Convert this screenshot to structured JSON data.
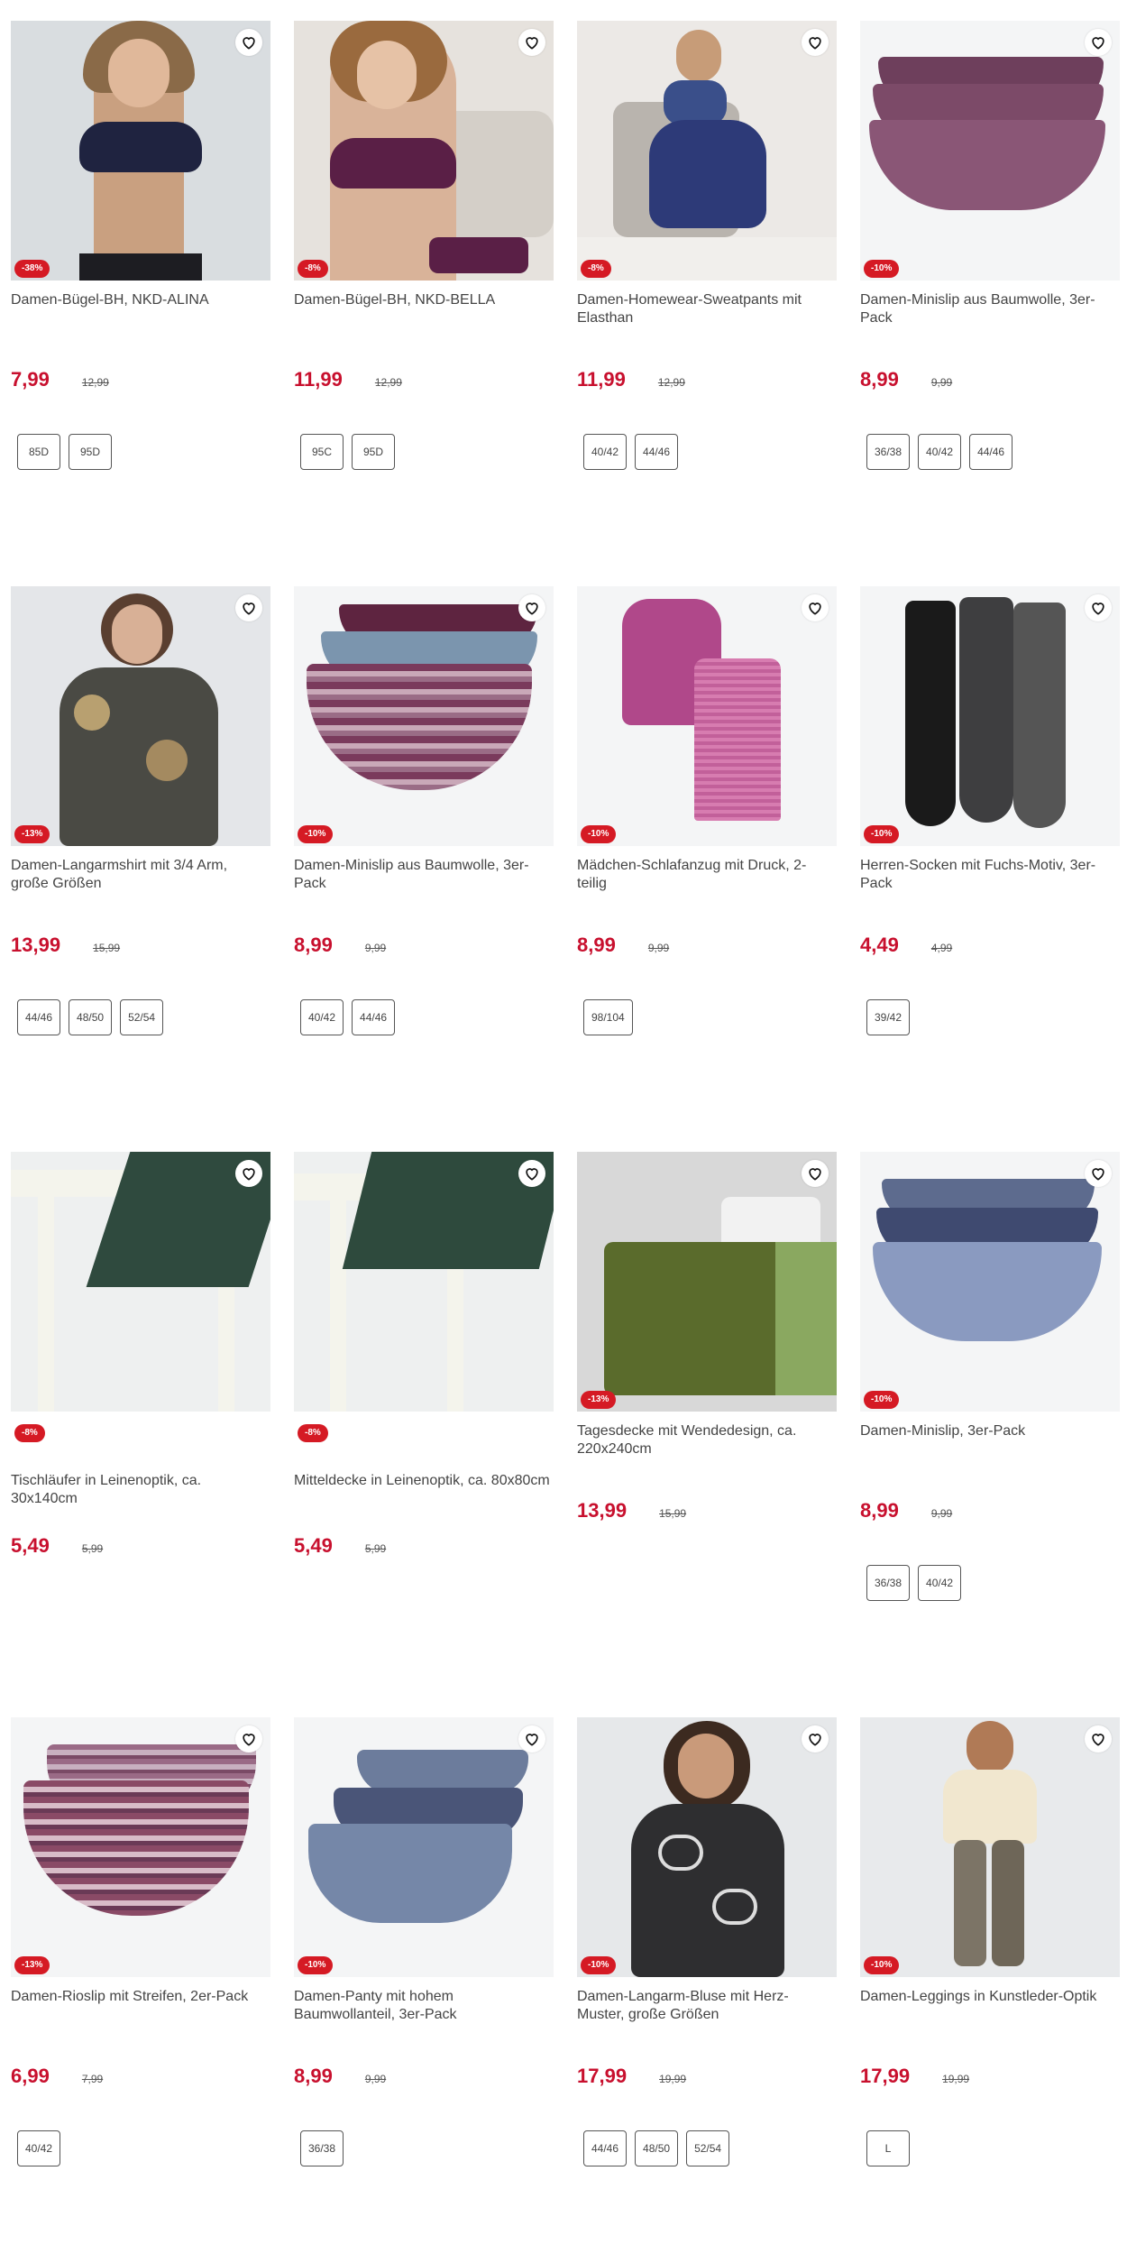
{
  "colors": {
    "sale_red": "#c8102e",
    "badge_red": "#d51a24"
  },
  "products": [
    {
      "title": "Damen-Bügel-BH, NKD-ALINA",
      "discount": "-38%",
      "price": "7,99",
      "old_price": "12,99",
      "sizes": [
        "85D",
        "95D"
      ]
    },
    {
      "title": "Damen-Bügel-BH, NKD-BELLA",
      "discount": "-8%",
      "price": "11,99",
      "old_price": "12,99",
      "sizes": [
        "95C",
        "95D"
      ]
    },
    {
      "title": "Damen-Homewear-Sweatpants mit Elasthan",
      "discount": "-8%",
      "price": "11,99",
      "old_price": "12,99",
      "sizes": [
        "40/42",
        "44/46"
      ]
    },
    {
      "title": "Damen-Minislip aus Baumwolle, 3er-Pack",
      "discount": "-10%",
      "price": "8,99",
      "old_price": "9,99",
      "sizes": [
        "36/38",
        "40/42",
        "44/46"
      ]
    },
    {
      "title": "Damen-Langarmshirt mit 3/4 Arm, große Größen",
      "discount": "-13%",
      "price": "13,99",
      "old_price": "15,99",
      "sizes": [
        "44/46",
        "48/50",
        "52/54"
      ]
    },
    {
      "title": "Damen-Minislip aus Baumwolle, 3er-Pack",
      "discount": "-10%",
      "price": "8,99",
      "old_price": "9,99",
      "sizes": [
        "40/42",
        "44/46"
      ]
    },
    {
      "title": "Mädchen-Schlafanzug mit Druck, 2-teilig",
      "discount": "-10%",
      "price": "8,99",
      "old_price": "9,99",
      "sizes": [
        "98/104"
      ]
    },
    {
      "title": "Herren-Socken mit Fuchs-Motiv, 3er-Pack",
      "discount": "-10%",
      "price": "4,49",
      "old_price": "4,99",
      "sizes": [
        "39/42"
      ]
    },
    {
      "title": "Tischläufer in Leinenoptik, ca. 30x140cm",
      "discount": "-8%",
      "price": "5,49",
      "old_price": "5,99",
      "sizes": []
    },
    {
      "title": "Mitteldecke in Leinenoptik, ca. 80x80cm",
      "discount": "-8%",
      "price": "5,49",
      "old_price": "5,99",
      "sizes": []
    },
    {
      "title": "Tagesdecke mit Wendedesign, ca. 220x240cm",
      "discount": "-13%",
      "price": "13,99",
      "old_price": "15,99",
      "sizes": []
    },
    {
      "title": "Damen-Minislip, 3er-Pack",
      "discount": "-10%",
      "price": "8,99",
      "old_price": "9,99",
      "sizes": [
        "36/38",
        "40/42"
      ]
    },
    {
      "title": "Damen-Rioslip mit Streifen, 2er-Pack",
      "discount": "-13%",
      "price": "6,99",
      "old_price": "7,99",
      "sizes": [
        "40/42"
      ]
    },
    {
      "title": "Damen-Panty mit hohem Baumwollanteil, 3er-Pack",
      "discount": "-10%",
      "price": "8,99",
      "old_price": "9,99",
      "sizes": [
        "36/38"
      ]
    },
    {
      "title": "Damen-Langarm-Bluse mit Herz-Muster, große Größen",
      "discount": "-10%",
      "price": "17,99",
      "old_price": "19,99",
      "sizes": [
        "44/46",
        "48/50",
        "52/54"
      ]
    },
    {
      "title": "Damen-Leggings in Kunstleder-Optik",
      "discount": "-10%",
      "price": "17,99",
      "old_price": "19,99",
      "sizes": [
        "L"
      ]
    }
  ]
}
